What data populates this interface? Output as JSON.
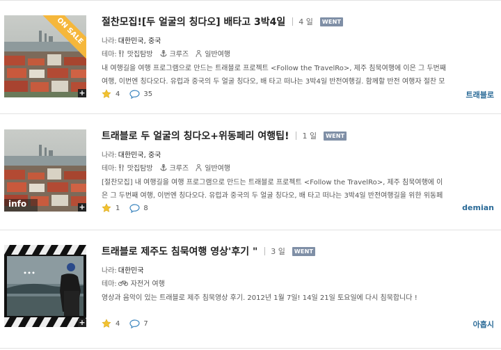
{
  "items": [
    {
      "title": "절찬모집![두 얼굴의 칭다오] 배타고 3박4일",
      "days": "4 일",
      "badge": "WENT",
      "sale_label": "ON SALE",
      "country_label": "나라:",
      "country": "대한민국, 중국",
      "theme_label": "테마:",
      "tags": [
        {
          "icon": "fork-knife-icon",
          "label": "맛집탐방"
        },
        {
          "icon": "anchor-icon",
          "label": "크루즈"
        },
        {
          "icon": "person-icon",
          "label": "일반여행"
        }
      ],
      "description": [
        "내 여행길을 여행 프로그램으로 만드는 트래블로 프로젝트 <Follow the TravelRo>, 제주 침묵여행에 이은 그 두번째",
        "여행, 이번엔 칭다오다. 유럽과 중국의 두 얼굴 칭다오, 배 타고 떠나는 3박4일 반전여행길. 함께할 반전 여행자 절찬 모"
      ],
      "likes": "4",
      "comments": "35",
      "author": "트래블로"
    },
    {
      "title": "트래블로 두 얼굴의 칭다오+위동페리 여행팁!",
      "days": "1 일",
      "badge": "WENT",
      "info_label": "info",
      "country_label": "나라:",
      "country": "대한민국, 중국",
      "theme_label": "테마:",
      "tags": [
        {
          "icon": "fork-knife-icon",
          "label": "맛집탐방"
        },
        {
          "icon": "anchor-icon",
          "label": "크루즈"
        },
        {
          "icon": "person-icon",
          "label": "일반여행"
        }
      ],
      "description": [
        "[절찬모집] 내 여행길을 여행 프로그램으로 만드는 트래블로 프로젝트 <Follow the TravelRo>, 제주 침묵여행에 이",
        "은 그 두번째 여행, 이번엔 칭다오다. 유럽과 중국의 두 얼굴 칭다오, 배 타고 떠나는 3박4일 반전여행길을 위한 위동페"
      ],
      "likes": "1",
      "comments": "8",
      "author": "demian"
    },
    {
      "title": "트래블로 제주도 침묵여행 영상'후기 \"",
      "days": "3 일",
      "badge": "WENT",
      "country_label": "나라:",
      "country": "대한민국",
      "theme_label": "테마:",
      "tags": [
        {
          "icon": "bicycle-icon",
          "label": "자전거 여행"
        }
      ],
      "description": [
        "영상과 음악이 있는 트래블로 제주 침묵영상 후기. 2012년 1월 7일! 14일 21일 토요일에 다시 침묵합니다 !"
      ],
      "likes": "4",
      "comments": "7",
      "author": "아홉시"
    }
  ],
  "colors": {
    "badge": "#7f8fa6",
    "author": "#2a6a97",
    "sale": "#f5b73b",
    "star": "#f2c230",
    "bubble": "#3d86bf"
  }
}
